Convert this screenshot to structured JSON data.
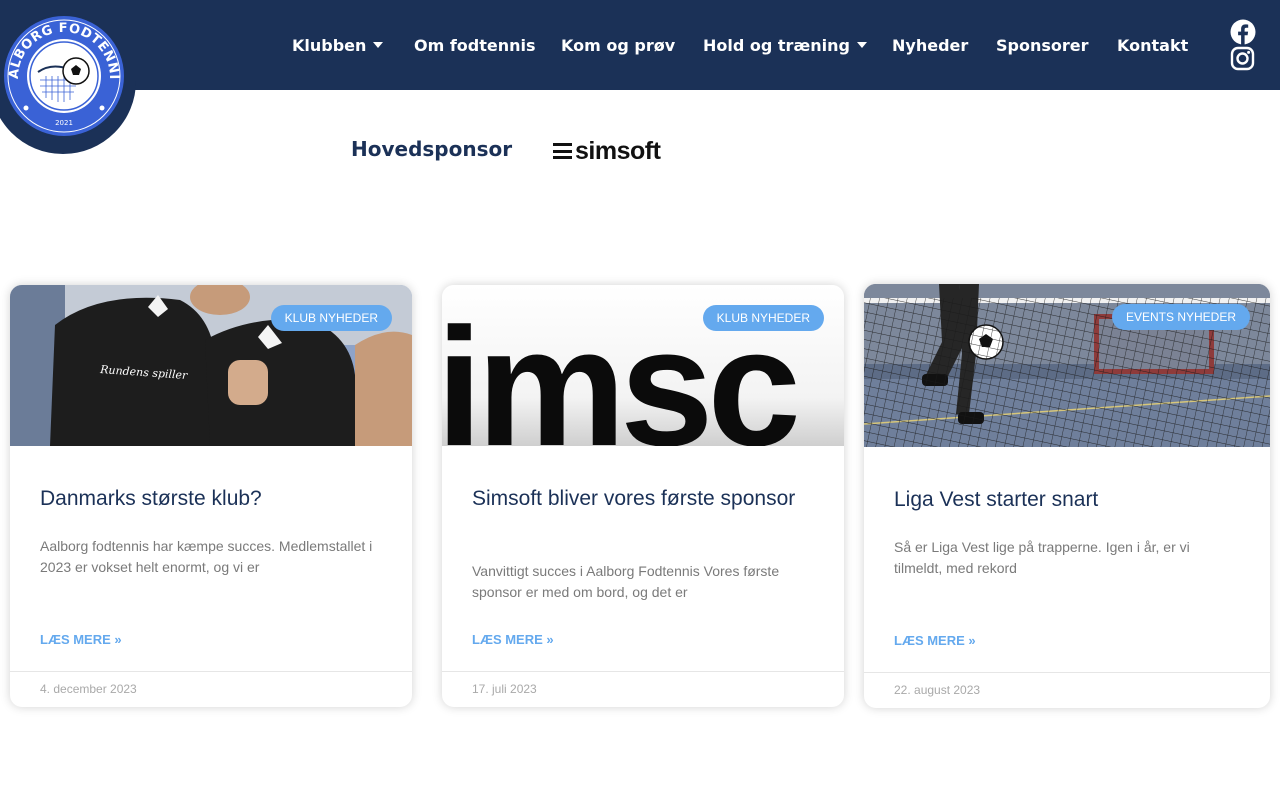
{
  "header": {
    "logo_text": "AALBORG FODTENNIS",
    "logo_year": "2021",
    "nav": [
      {
        "label": "Klubben",
        "dropdown": true
      },
      {
        "label": "Om fodtennis",
        "dropdown": false
      },
      {
        "label": "Kom og prøv",
        "dropdown": false
      },
      {
        "label": "Hold og træning",
        "dropdown": true
      },
      {
        "label": "Nyheder",
        "dropdown": false
      },
      {
        "label": "Sponsorer",
        "dropdown": false
      },
      {
        "label": "Kontakt",
        "dropdown": false
      }
    ],
    "social": [
      {
        "icon": "facebook-icon"
      },
      {
        "icon": "instagram-icon"
      }
    ]
  },
  "sponsor": {
    "label": "Hovedsponsor",
    "logo_text": "simsoft"
  },
  "posts": [
    {
      "category": "KLUB NYHEDER",
      "title": "Danmarks største klub?",
      "excerpt": "Aalborg fodtennis har kæmpe succes. Medlemstallet i 2023 er vokset helt enormt, og vi er",
      "read_more": "LÆS MERE »",
      "date": "4. december 2023",
      "image_caption": "Rundens spiller"
    },
    {
      "category": "KLUB NYHEDER",
      "title": "Simsoft bliver vores første sponsor",
      "excerpt": "Vanvittigt succes i Aalborg Fodtennis Vores første sponsor er med om bord, og det er",
      "read_more": "LÆS MERE »",
      "date": "17. juli 2023",
      "image_text": "imsc"
    },
    {
      "category": "EVENTS NYHEDER",
      "title": "Liga Vest starter snart",
      "excerpt": "Så er Liga Vest lige på trapperne. Igen i år, er vi tilmeldt, med rekord",
      "read_more": "LÆS MERE »",
      "date": "22. august 2023"
    }
  ],
  "colors": {
    "header_bg": "#1b3157",
    "accent": "#64a9ee",
    "title": "#1b3157",
    "excerpt": "#7a7a7a",
    "date": "#a9a9a9"
  }
}
